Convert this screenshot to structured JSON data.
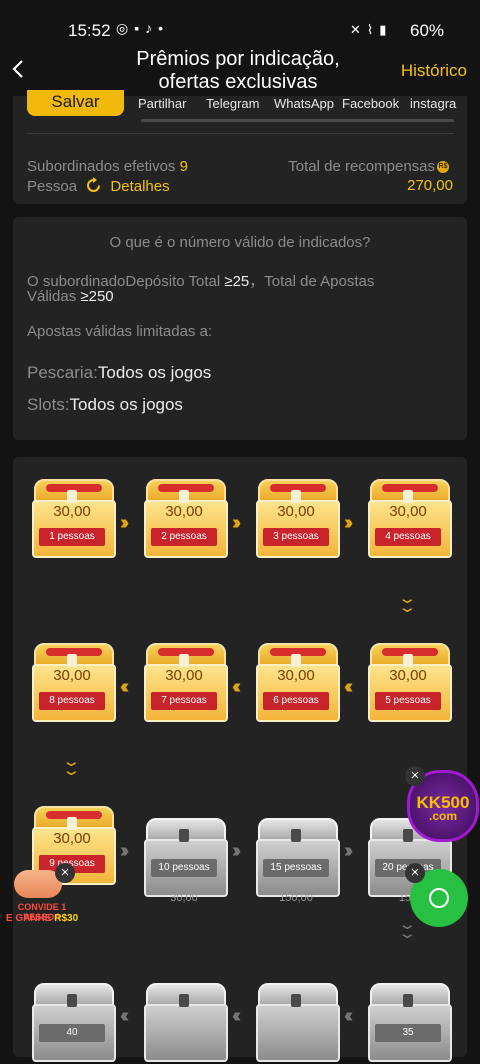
{
  "status_bar": {
    "time": "15:52",
    "battery": "60%"
  },
  "header": {
    "title_line1": "Prêmios por indicação,",
    "title_line2": "ofertas exclusivas",
    "history": "Histórico"
  },
  "share": {
    "save": "Salvar",
    "options": [
      "Partilhar",
      "Telegram",
      "WhatsApp",
      "Facebook",
      "instagra"
    ]
  },
  "stats": {
    "subordinates_label": "Subordinados efetivos",
    "subordinates_value": "9",
    "people_label": "Pessoa",
    "details": "Detalhes",
    "total_label": "Total de recompensas",
    "currency_icon": "R$",
    "total_value": "270,00"
  },
  "info": {
    "title": "O que é o número válido de indicados?",
    "rule_line1_a": "O subordinadoDepósito Total ",
    "rule_line1_b": "≥25",
    "rule_line1_c": "，Total de Apostas",
    "rule_line2_a": "Válidas ",
    "rule_line2_b": "≥250",
    "limited": "Apostas válidas limitadas a:",
    "fishing_label": "Pescaria:",
    "fishing_value": "Todos os jogos",
    "slots_label": "Slots:",
    "slots_value": "Todos os jogos"
  },
  "rewards": {
    "row1": [
      {
        "amount": "30,00",
        "label": "1 pessoas"
      },
      {
        "amount": "30,00",
        "label": "2 pessoas"
      },
      {
        "amount": "30,00",
        "label": "3 pessoas"
      },
      {
        "amount": "30,00",
        "label": "4 pessoas"
      }
    ],
    "row2": [
      {
        "amount": "30,00",
        "label": "8 pessoas"
      },
      {
        "amount": "30,00",
        "label": "7 pessoas"
      },
      {
        "amount": "30,00",
        "label": "6 pessoas"
      },
      {
        "amount": "30,00",
        "label": "5 pessoas"
      }
    ],
    "row3": [
      {
        "amount": "30,00",
        "label": "9 pessoas"
      },
      {
        "label": "10 pessoas",
        "value": "30,00"
      },
      {
        "label": "15 pessoas",
        "value": "150,00"
      },
      {
        "label": "20 pessoas",
        "value": "150"
      }
    ],
    "row4_labels": [
      "40",
      "35"
    ]
  },
  "overlays": {
    "kk_line1": "KK500",
    "kk_line2": ".com",
    "promo_line1": "CONVIDE 1 PESSOA",
    "promo_line2": "E GANHE",
    "promo_amount": "R$30"
  }
}
